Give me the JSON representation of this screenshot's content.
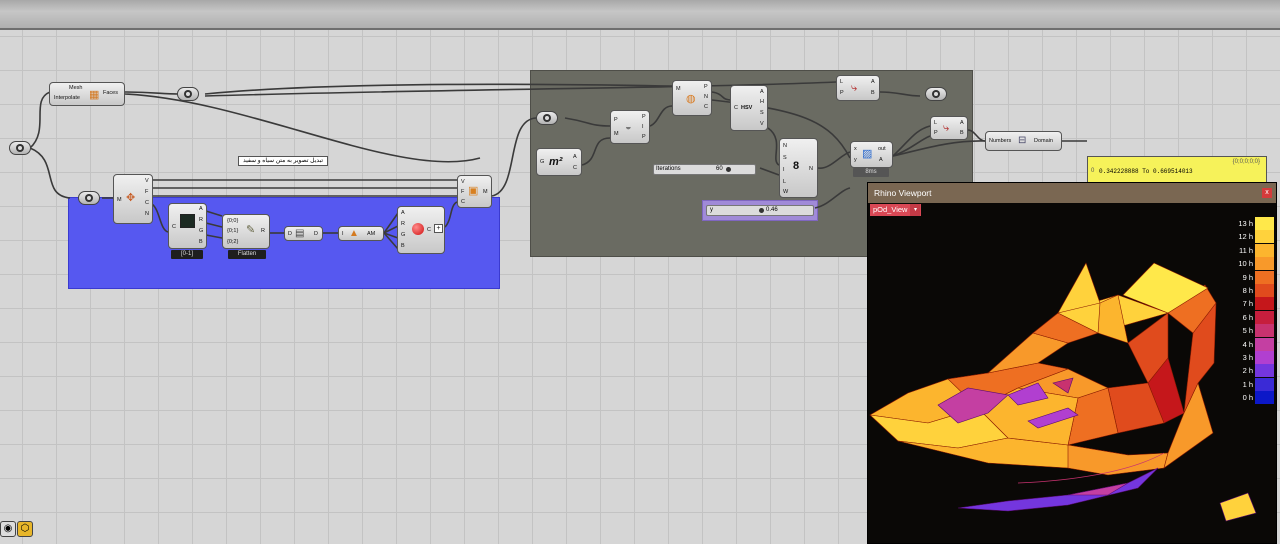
{
  "components": {
    "mesh_faces": {
      "in1": "Mesh",
      "in2": "Interpolate",
      "out": "Faces"
    },
    "deconstruct_mesh": {
      "in": "M",
      "outs": [
        "V",
        "F",
        "C",
        "N"
      ]
    },
    "image_sampler": {
      "in": "C",
      "outs": [
        "A",
        "R",
        "G",
        "B"
      ],
      "tag": "[0-1]"
    },
    "flatten": {
      "items": [
        "{0;0}",
        "{0;1}",
        "{0;2}"
      ],
      "out": "R",
      "tag": "Flatten"
    },
    "data": {
      "in": "D",
      "out": "D"
    },
    "average": {
      "in": "I",
      "out": "AM"
    },
    "colour": {
      "ins": [
        "A",
        "R",
        "G",
        "B"
      ],
      "out": "C",
      "plus": "+"
    },
    "construct_mesh": {
      "ins": [
        "V",
        "F",
        "C"
      ],
      "out": "M"
    },
    "area": {
      "in": "G",
      "outs": [
        "A",
        "C"
      ]
    },
    "mesh_closest": {
      "ins": [
        "P",
        "M"
      ],
      "outs": [
        "P",
        "I",
        "P"
      ]
    },
    "normals": {
      "in": "M",
      "outs": [
        "P",
        "N",
        "C"
      ]
    },
    "hsv": {
      "in": "C",
      "label": "HSV",
      "outs": [
        "A",
        "H",
        "S",
        "V"
      ]
    },
    "sun_hours": {
      "ins": [
        "N",
        "S",
        "I",
        "L",
        "W"
      ],
      "out": "N"
    },
    "list_item_1": {
      "ins": [
        "L",
        "P"
      ],
      "outs": [
        "A",
        "B"
      ]
    },
    "list_item_2": {
      "ins": [
        "L",
        "P"
      ],
      "outs": [
        "A",
        "B"
      ]
    },
    "script": {
      "ins": [
        "x",
        "y"
      ],
      "outs": [
        "out",
        "A"
      ],
      "tag": "8ms"
    },
    "bounds": {
      "in": "Numbers",
      "out": "Domain"
    }
  },
  "group_note": "تبدیل تصویر به متن سیاه و سفید",
  "sliders": {
    "iterations": {
      "label": "Iterations",
      "value": "60"
    },
    "y": {
      "label": "y",
      "value": "0.46"
    }
  },
  "panel": {
    "header": "{0;0;0;0;0}",
    "index": "0",
    "text": "0.342228888 To 0.669514013"
  },
  "viewport": {
    "title": "Rhino Viewport",
    "close": "x",
    "tab": "pOd_View",
    "tab_arrow": "▾"
  },
  "legend": [
    {
      "label": "13 h",
      "color": "#ffe84a"
    },
    {
      "label": "12 h",
      "color": "#ffd23c"
    },
    {
      "label": "11 h",
      "color": "#fcb52e"
    },
    {
      "label": "10 h",
      "color": "#f8992a"
    },
    {
      "label": "9 h",
      "color": "#ee6f22"
    },
    {
      "label": "8 h",
      "color": "#e04b1d"
    },
    {
      "label": "7 h",
      "color": "#c5171b"
    },
    {
      "label": "6 h",
      "color": "#c61e3d"
    },
    {
      "label": "5 h",
      "color": "#c8326f"
    },
    {
      "label": "4 h",
      "color": "#c43fa2"
    },
    {
      "label": "3 h",
      "color": "#b13fd0"
    },
    {
      "label": "2 h",
      "color": "#7436de"
    },
    {
      "label": "1 h",
      "color": "#3a2ad6"
    },
    {
      "label": "0 h",
      "color": "#0c18c8"
    }
  ]
}
